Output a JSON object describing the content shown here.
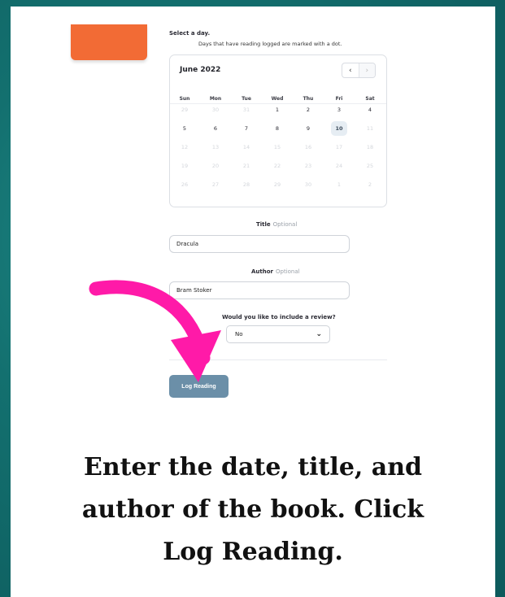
{
  "form": {
    "select_day_label": "Select a day.",
    "days_hint": "Days that have reading logged are marked with a dot.",
    "calendar": {
      "month_title": "June 2022",
      "prev_icon": "‹",
      "next_icon": "›",
      "weekdays": [
        "Sun",
        "Mon",
        "Tue",
        "Wed",
        "Thu",
        "Fri",
        "Sat"
      ],
      "weeks": [
        [
          {
            "d": "29",
            "m": true
          },
          {
            "d": "30",
            "m": true
          },
          {
            "d": "31",
            "m": true
          },
          {
            "d": "1"
          },
          {
            "d": "2"
          },
          {
            "d": "3"
          },
          {
            "d": "4"
          }
        ],
        [
          {
            "d": "5"
          },
          {
            "d": "6"
          },
          {
            "d": "7"
          },
          {
            "d": "8"
          },
          {
            "d": "9"
          },
          {
            "d": "10",
            "sel": true
          },
          {
            "d": "11",
            "m": true
          }
        ],
        [
          {
            "d": "12",
            "m": true
          },
          {
            "d": "13",
            "m": true
          },
          {
            "d": "14",
            "m": true
          },
          {
            "d": "15",
            "m": true
          },
          {
            "d": "16",
            "m": true
          },
          {
            "d": "17",
            "m": true
          },
          {
            "d": "18",
            "m": true
          }
        ],
        [
          {
            "d": "19",
            "m": true
          },
          {
            "d": "20",
            "m": true
          },
          {
            "d": "21",
            "m": true
          },
          {
            "d": "22",
            "m": true
          },
          {
            "d": "23",
            "m": true
          },
          {
            "d": "24",
            "m": true
          },
          {
            "d": "25",
            "m": true
          }
        ],
        [
          {
            "d": "26",
            "m": true
          },
          {
            "d": "27",
            "m": true
          },
          {
            "d": "28",
            "m": true
          },
          {
            "d": "29",
            "m": true
          },
          {
            "d": "30",
            "m": true
          },
          {
            "d": "1",
            "m": true
          },
          {
            "d": "2",
            "m": true
          }
        ]
      ]
    },
    "title_label": "Title",
    "title_optional": "Optional",
    "title_value": "Dracula",
    "author_label": "Author",
    "author_optional": "Optional",
    "author_value": "Bram Stoker",
    "review_question": "Would you like to include a review?",
    "review_selected": "No",
    "review_chevron_icon": "chevron-down-icon",
    "submit_label": "Log Reading"
  },
  "caption": {
    "line1": "Enter the date, title, and",
    "line2": "author of the book. Click",
    "line3": "Log Reading."
  },
  "colors": {
    "background": "#13706f",
    "orange_block": "#f26b35",
    "button": "#6b8fa8",
    "arrow": "#ff1aa8"
  }
}
